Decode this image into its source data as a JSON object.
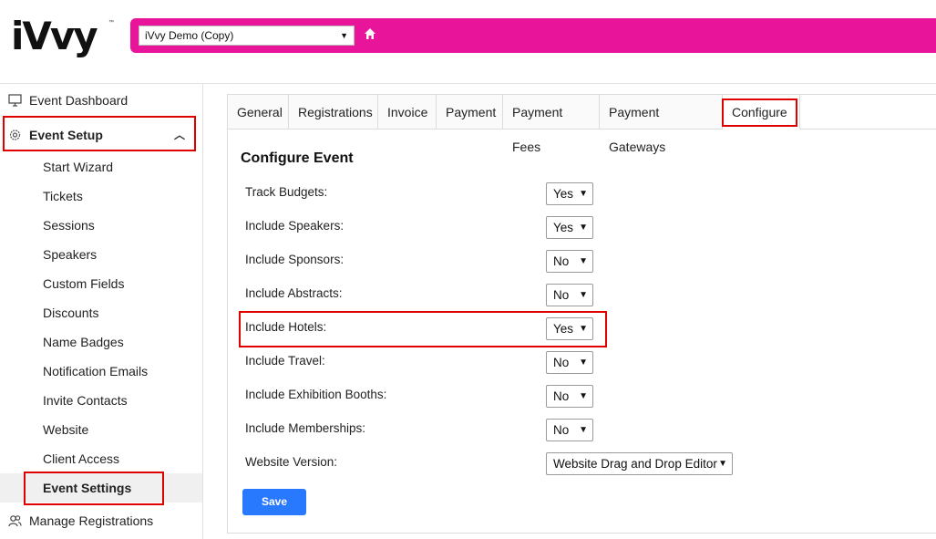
{
  "brand": {
    "logo_text": "iVvy",
    "trademark": "™"
  },
  "header": {
    "event_select_value": "iVvy Demo (Copy)",
    "home_icon": "home-icon",
    "bar_color": "#e8149a"
  },
  "sidebar": {
    "items": [
      {
        "label": "Event Dashboard",
        "icon": "monitor-icon"
      },
      {
        "label": "Event Setup",
        "icon": "gear-icon"
      },
      {
        "label": "Start Wizard"
      },
      {
        "label": "Tickets"
      },
      {
        "label": "Sessions"
      },
      {
        "label": "Speakers"
      },
      {
        "label": "Custom Fields"
      },
      {
        "label": "Discounts"
      },
      {
        "label": "Name Badges"
      },
      {
        "label": "Notification Emails"
      },
      {
        "label": "Invite Contacts"
      },
      {
        "label": "Website"
      },
      {
        "label": "Client Access"
      },
      {
        "label": "Event Settings"
      },
      {
        "label": "Manage Registrations",
        "icon": "users-icon"
      }
    ]
  },
  "tabs": [
    {
      "label": "General"
    },
    {
      "label": "Registrations"
    },
    {
      "label": "Invoice"
    },
    {
      "label": "Payment"
    },
    {
      "label": "Payment Fees"
    },
    {
      "label": "Payment Gateways"
    },
    {
      "label": "Configure"
    }
  ],
  "configure": {
    "title": "Configure Event",
    "rows": [
      {
        "label": "Track Budgets:",
        "value": "Yes"
      },
      {
        "label": "Include Speakers:",
        "value": "Yes"
      },
      {
        "label": "Include Sponsors:",
        "value": "No"
      },
      {
        "label": "Include Abstracts:",
        "value": "No"
      },
      {
        "label": "Include Hotels:",
        "value": "Yes"
      },
      {
        "label": "Include Travel:",
        "value": "No"
      },
      {
        "label": "Include Exhibition Booths:",
        "value": "No"
      },
      {
        "label": "Include Memberships:",
        "value": "No"
      },
      {
        "label": "Website Version:",
        "value": "Website Drag and Drop Editor"
      }
    ],
    "save_label": "Save"
  },
  "colors": {
    "accent": "#e8149a",
    "primary_button": "#2979ff",
    "highlight": "#e00000"
  }
}
